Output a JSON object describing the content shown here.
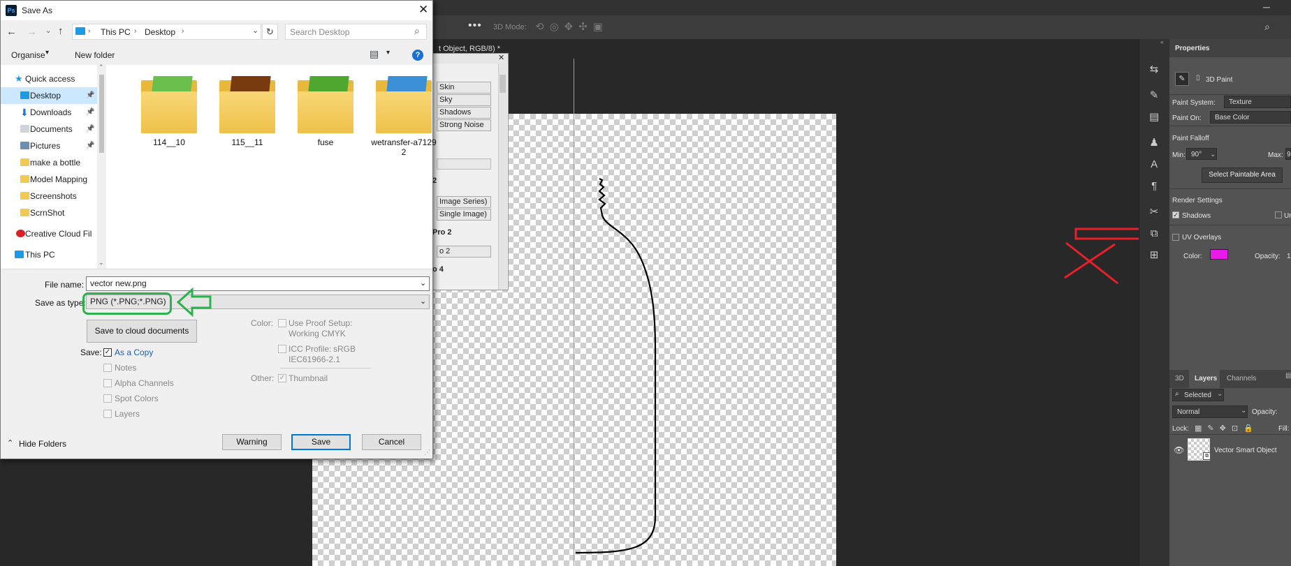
{
  "dialog": {
    "title": "Save As",
    "app_badge": "Ps",
    "breadcrumb": [
      "This PC",
      "Desktop"
    ],
    "search_placeholder": "Search Desktop",
    "organise_label": "Organise",
    "new_folder_label": "New folder",
    "help_glyph": "?",
    "nav_items": [
      {
        "label": "Quick access",
        "icon": "star-icon"
      },
      {
        "label": "Desktop",
        "icon": "desktop-icon",
        "pinned": true,
        "selected": true
      },
      {
        "label": "Downloads",
        "icon": "download-icon",
        "pinned": true
      },
      {
        "label": "Documents",
        "icon": "documents-icon",
        "pinned": true
      },
      {
        "label": "Pictures",
        "icon": "pictures-icon",
        "pinned": true
      },
      {
        "label": "make a bottle",
        "icon": "folder-icon"
      },
      {
        "label": "Model Mapping",
        "icon": "folder-icon"
      },
      {
        "label": "Screenshots",
        "icon": "folder-icon"
      },
      {
        "label": "ScrnShot",
        "icon": "folder-icon"
      },
      {
        "label": "Creative Cloud Fil",
        "icon": "creative-cloud-icon"
      },
      {
        "label": "This PC",
        "icon": "computer-icon"
      }
    ],
    "files": [
      {
        "name": "114__10",
        "accent": "#6bbf4c"
      },
      {
        "name": "115__11",
        "accent": "#7a3a10"
      },
      {
        "name": "fuse",
        "accent": "#4ea72e"
      },
      {
        "name": "wetransfer-a71292",
        "accent": "#3b8fd6"
      }
    ],
    "file_name_label": "File name:",
    "file_name_value": "vector new.png",
    "save_type_label": "Save as type:",
    "save_type_value": "PNG (*.PNG;*.PNG)",
    "cloud_button": "Save to cloud documents",
    "save_label": "Save:",
    "save_options": [
      {
        "label": "As a Copy",
        "checked": true,
        "enabled": true
      },
      {
        "label": "Notes",
        "checked": false,
        "enabled": false
      },
      {
        "label": "Alpha Channels",
        "checked": false,
        "enabled": false
      },
      {
        "label": "Spot Colors",
        "checked": false,
        "enabled": false
      },
      {
        "label": "Layers",
        "checked": false,
        "enabled": false
      }
    ],
    "color_label": "Color:",
    "proof_label": "Use Proof Setup:",
    "proof_value": "Working CMYK",
    "icc_label": "ICC Profile:",
    "icc_value": "sRGB",
    "icc_value2": "IEC61966-2.1",
    "other_label": "Other:",
    "thumbnail_label": "Thumbnail",
    "hide_folders": "Hide Folders",
    "warning_button": "Warning",
    "save_button": "Save",
    "cancel_button": "Cancel"
  },
  "plugin_panel": {
    "buttons": [
      "Skin",
      "Sky",
      "Shadows",
      "Strong Noise"
    ],
    "label_2": "2",
    "image_series": "Image Series)",
    "single_image": "Single Image)",
    "pro2": "Pro 2",
    "o2": "o 2",
    "o4": "o 4"
  },
  "photoshop": {
    "doc_tab": "t Object, RGB/8) *",
    "mode_label": "3D Mode:",
    "properties": {
      "title": "Properties",
      "mode": "3D Paint",
      "paint_system_label": "Paint System:",
      "paint_system_value": "Texture",
      "paint_on_label": "Paint On:",
      "paint_on_value": "Base Color",
      "falloff_label": "Paint Falloff",
      "min_label": "Min:",
      "min_value": "90°",
      "max_label": "Max:",
      "max_value": "9",
      "select_area_button": "Select Paintable Area",
      "render_settings": "Render Settings",
      "shadows_label": "Shadows",
      "un_label": "Ur",
      "uv_overlays_label": "UV Overlays",
      "color_label": "Color:",
      "overlay_color": "#e81be8",
      "opacity_label": "Opacity:",
      "opacity_value": "1"
    },
    "layers": {
      "tabs": [
        "3D",
        "Layers",
        "Channels"
      ],
      "filter_value": "Selected",
      "blend_mode": "Normal",
      "opacity_label": "Opacity:",
      "lock_label": "Lock:",
      "fill_label": "Fill:",
      "layer_name": "Vector Smart Object"
    }
  },
  "annotations": {
    "arrow_color": "#e8202a",
    "highlight_color": "#2bb24c",
    "ring_color": "#000000"
  }
}
